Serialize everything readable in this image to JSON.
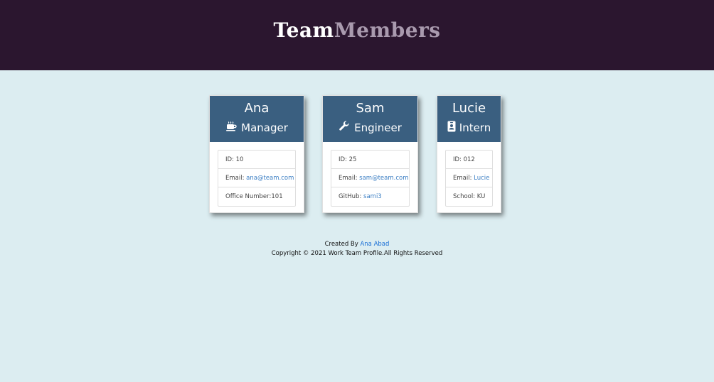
{
  "header": {
    "brand_part1": "Team",
    "brand_part2": "Members",
    "background": "#2b162f"
  },
  "cards": [
    {
      "name": "Ana",
      "role": "Manager",
      "role_icon": "coffee-icon",
      "id_text": "ID: 10",
      "email_label": "Email: ",
      "email": "ana@team.com",
      "extra_label": "Office Number:",
      "extra_value": "101"
    },
    {
      "name": "Sam",
      "role": "Engineer",
      "role_icon": "wrench-icon",
      "id_text": "ID: 25",
      "email_label": "Email: ",
      "email": "sam@team.com",
      "extra_label": "GitHub: ",
      "extra_value": "sami3"
    },
    {
      "name": "Lucie",
      "role": "Intern",
      "role_icon": "id-badge-icon",
      "id_text": "ID: 012",
      "email_label": "Email: ",
      "email": "Lucie",
      "extra_label": "School: ",
      "extra_value": "KU"
    }
  ],
  "footer": {
    "created_by": "Created By ",
    "author": "Ana Abad",
    "copyright": "Copyright © 2021 Work Team Profile.All Rights Reserved"
  },
  "colors": {
    "page_background": "#dcedf1",
    "card_header": "#3a5f80",
    "link": "#3c7fc4"
  }
}
